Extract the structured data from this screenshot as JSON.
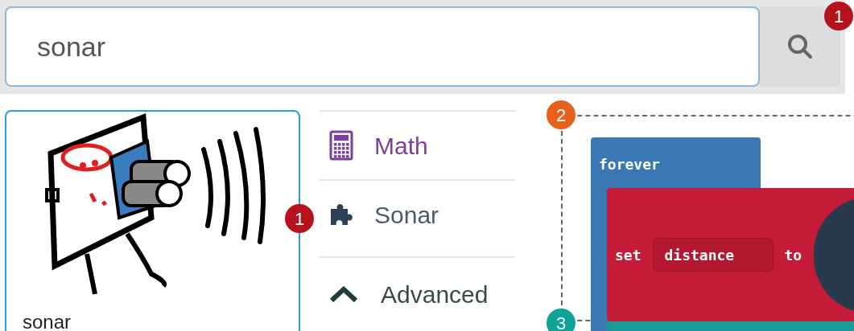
{
  "search": {
    "value": "sonar"
  },
  "extension_card": {
    "name": "sonar"
  },
  "categories": [
    {
      "label": "Math",
      "kind": "math"
    },
    {
      "label": "Sonar",
      "kind": "extension"
    }
  ],
  "advanced": {
    "label": "Advanced",
    "expanded": true
  },
  "blocks": {
    "forever": "forever",
    "set_keyword": "set",
    "variable": "distance",
    "to_keyword": "to"
  },
  "callouts": [
    {
      "label": "1",
      "color": "#b5121b"
    },
    {
      "label": "1",
      "color": "#b5121b"
    },
    {
      "label": "2",
      "color": "#e8601c"
    },
    {
      "label": "3",
      "color": "#0ea396"
    }
  ]
}
